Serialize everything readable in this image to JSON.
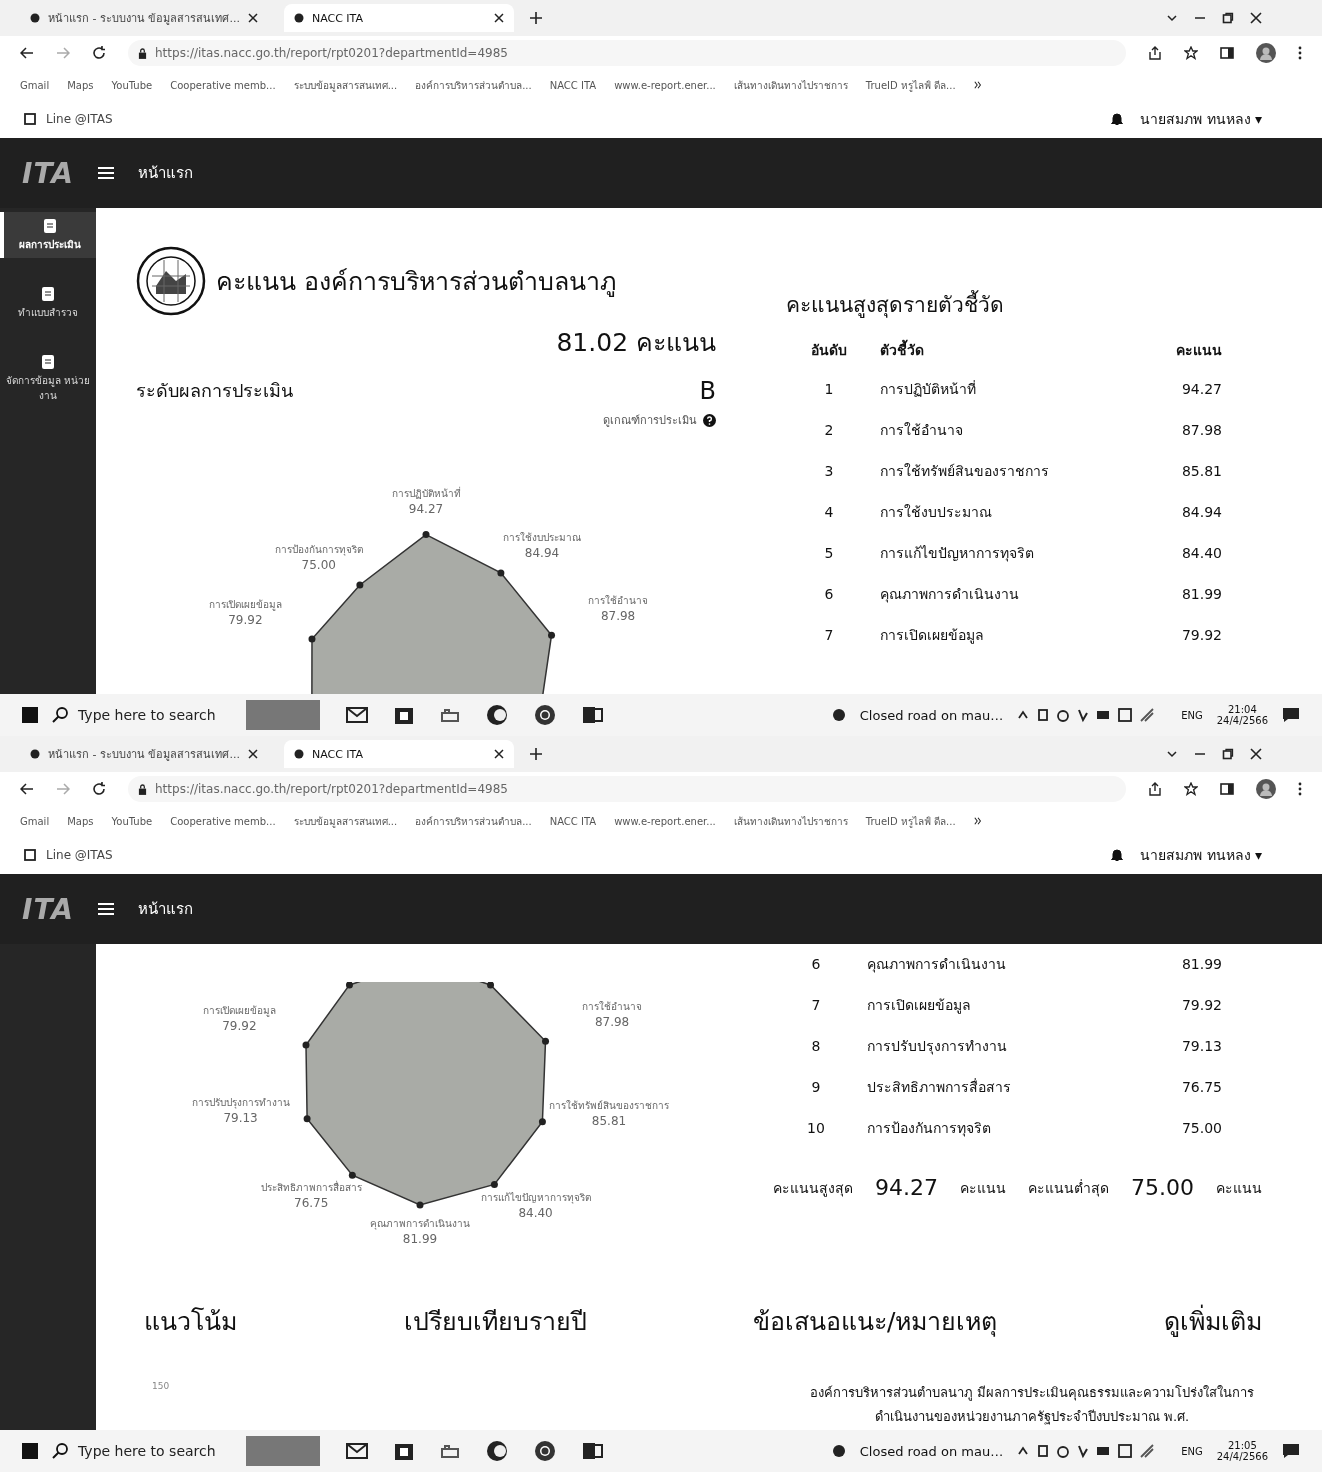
{
  "screens": [
    {
      "browser": {
        "tabs": [
          {
            "title": "หน้าแรก - ระบบงาน ข้อมูลสารสนเทศ...",
            "selected": false
          },
          {
            "title": "NACC ITA",
            "selected": true
          }
        ],
        "url": "https://itas.nacc.go.th/report/rpt0201?departmentId=4985",
        "bookmarks": [
          "Gmail",
          "Maps",
          "YouTube",
          "Cooperative memb...",
          "ระบบข้อมูลสารสนเทศ...",
          "องค์การบริหารส่วนตำบล...",
          "NACC ITA",
          "www.e-report.ener...",
          "เส้นทางเดินทางไปราชการ",
          "TrueID หรูไลฟ์ ดีล..."
        ]
      },
      "topbar": {
        "link": "Line @ITAS",
        "user": "นายสมภพ ทนหลง ▾"
      },
      "app": {
        "brand": "ITA",
        "nav": "หน้าแรก"
      },
      "sidebar": [
        {
          "label": "ผลการประเมิน",
          "selected": true
        },
        {
          "label": "ทำแบบสำรวจ",
          "selected": false
        },
        {
          "label": "จัดการข้อมูล หน่วยงาน",
          "selected": false
        }
      ],
      "header": {
        "title": "คะแนน องค์การบริหารส่วนตำบลนาภู",
        "score": "81.02 คะแนน",
        "grade_label": "ระดับผลการประเมิน",
        "grade": "B",
        "criteria_link": "ดูเกณฑ์การประเมิน"
      },
      "radar": {
        "top": {
          "label": "การปฏิบัติหน้าที่",
          "value": "94.27"
        },
        "top_left": {
          "label": "การป้องกันการทุจริต",
          "value": "75.00"
        },
        "top_right": {
          "label": "การใช้งบประมาณ",
          "value": "84.94"
        },
        "left_upper": {
          "label": "การเปิดเผยข้อมูล",
          "value": "79.92"
        },
        "right_upper": {
          "label": "การใช้อำนาจ",
          "value": "87.98"
        }
      },
      "ranking": {
        "title": "คะแนนสูงสุดรายตัวชี้วัด",
        "columns": [
          "อันดับ",
          "ตัวชี้วัด",
          "คะแนน"
        ],
        "rows": [
          {
            "rank": "1",
            "name": "การปฏิบัติหน้าที่",
            "score": "94.27"
          },
          {
            "rank": "2",
            "name": "การใช้อำนาจ",
            "score": "87.98"
          },
          {
            "rank": "3",
            "name": "การใช้ทรัพย์สินของราชการ",
            "score": "85.81"
          },
          {
            "rank": "4",
            "name": "การใช้งบประมาณ",
            "score": "84.94"
          },
          {
            "rank": "5",
            "name": "การแก้ไขปัญหาการทุจริต",
            "score": "84.40"
          },
          {
            "rank": "6",
            "name": "คุณภาพการดำเนินงาน",
            "score": "81.99"
          },
          {
            "rank": "7",
            "name": "การเปิดเผยข้อมูล",
            "score": "79.92"
          }
        ]
      },
      "taskbar": {
        "search_placeholder": "Type here to search",
        "news": "Closed road on mau…",
        "lang": "ENG",
        "time": "21:04",
        "date": "24/4/2566"
      }
    },
    {
      "browser": {
        "tabs": [
          {
            "title": "หน้าแรก - ระบบงาน ข้อมูลสารสนเทศ...",
            "selected": false
          },
          {
            "title": "NACC ITA",
            "selected": true
          }
        ],
        "url": "https://itas.nacc.go.th/report/rpt0201?departmentId=4985",
        "bookmarks": [
          "Gmail",
          "Maps",
          "YouTube",
          "Cooperative memb...",
          "ระบบข้อมูลสารสนเทศ...",
          "องค์การบริหารส่วนตำบล...",
          "NACC ITA",
          "www.e-report.ener...",
          "เส้นทางเดินทางไปราชการ",
          "TrueID หรูไลฟ์ ดีล..."
        ]
      },
      "topbar": {
        "link": "Line @ITAS",
        "user": "นายสมภพ ทนหลง ▾"
      },
      "app": {
        "brand": "ITA",
        "nav": "หน้าแรก"
      },
      "radar": {
        "left_upper": {
          "label": "การเปิดเผยข้อมูล",
          "value": "79.92"
        },
        "right_upper": {
          "label": "การใช้อำนาจ",
          "value": "87.98"
        },
        "left_lower": {
          "label": "การปรับปรุงการทำงาน",
          "value": "79.13"
        },
        "right_lower": {
          "label": "การใช้ทรัพย์สินของราชการ",
          "value": "85.81"
        },
        "bottom_left": {
          "label": "ประสิทธิภาพการสื่อสาร",
          "value": "76.75"
        },
        "bottom_right": {
          "label": "การแก้ไขปัญหาการทุจริต",
          "value": "84.40"
        },
        "bottom": {
          "label": "คุณภาพการดำเนินงาน",
          "value": "81.99"
        }
      },
      "ranking": {
        "rows": [
          {
            "rank": "6",
            "name": "คุณภาพการดำเนินงาน",
            "score": "81.99"
          },
          {
            "rank": "7",
            "name": "การเปิดเผยข้อมูล",
            "score": "79.92"
          },
          {
            "rank": "8",
            "name": "การปรับปรุงการทำงาน",
            "score": "79.13"
          },
          {
            "rank": "9",
            "name": "ประสิทธิภาพการสื่อสาร",
            "score": "76.75"
          },
          {
            "rank": "10",
            "name": "การป้องกันการทุจริต",
            "score": "75.00"
          }
        ]
      },
      "summary": {
        "max_label": "คะแนนสูงสุด",
        "max_value": "94.27",
        "max_unit": "คะแนน",
        "min_label": "คะแนนต่ำสุด",
        "min_value": "75.00",
        "min_unit": "คะแนน"
      },
      "sections": [
        "แนวโน้ม",
        "เปรียบเทียบรายปี",
        "ข้อเสนอแนะ/หมายเหตุ",
        "ดูเพิ่มเติม"
      ],
      "axis_label": "150",
      "note": "องค์การบริหารส่วนตำบลนาภู มีผลการประเมินคุณธรรมและความโปร่งใสในการดำเนินงานของหน่วยงานภาครัฐประจำปีงบประมาณ พ.ศ.",
      "taskbar": {
        "search_placeholder": "Type here to search",
        "news": "Closed road on mau…",
        "lang": "ENG",
        "time": "21:05",
        "date": "24/4/2566"
      }
    }
  ]
}
